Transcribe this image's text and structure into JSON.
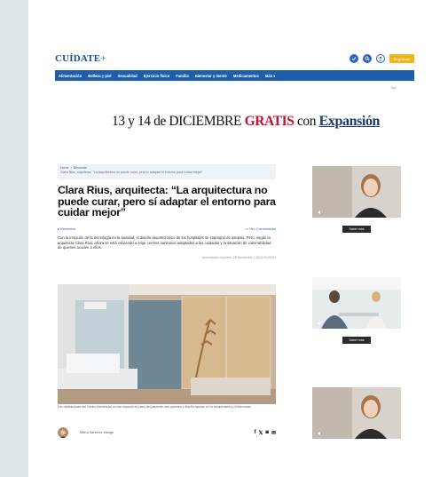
{
  "header": {
    "logo_main": "CUÍDATE",
    "logo_accent": "+",
    "register_label": "Regístrate"
  },
  "nav": {
    "items": [
      "Alimentación",
      "Belleza y piel",
      "Sexualidad",
      "Ejercicio físico",
      "Familia",
      "Bienestar y mente",
      "Medicamentos",
      "Más"
    ]
  },
  "ad_label": "Ad",
  "promo": {
    "before": "13 y 14 de DICIEMBRE",
    "red": "GRATIS",
    "middle": "con",
    "brand": "Expansión"
  },
  "article": {
    "breadcrumb_root": "Home",
    "breadcrumb_section": "Bienestar",
    "breadcrumb_current": "Clara Rius, arquitecta: \"La arquitectura no puede curar, pero sí adaptar el entorno para cuidar mejor\"",
    "title": "Clara Rius, arquitecta: “La arquitectura no puede curar, pero sí adaptar el entorno para cuidar mejor”",
    "section": "Bienestar",
    "comments": "Ver Comentarios",
    "lead": "Con la irrupción de la tecnología en la sanidad, el diseño arquitectónico de los hospitales se impregnó de asepsia. Pero, según la arquitecta Clara Rius, ahora se está volviendo a erigir centros sanitarios adaptados a los cuidados y la situación de vulnerabilidad de quienes acuden a ellos.",
    "date": "Actualizado a jueves, 28 Noviembre | 2024 09:32:39",
    "caption": "Las habitaciones del Centro Asistencial no son espacio de paso del paciente: sus paredes y diseño ayudan en la recuperación y el bienestar.",
    "author": "María Sánchez Monge"
  },
  "sidebar": {
    "videos": [
      {
        "button_label": "Saber más"
      },
      {
        "button_label": "Saber más"
      },
      {
        "button_label": ""
      }
    ]
  },
  "colors": {
    "nav_blue": "#1f5ea8",
    "accent_red": "#c8102e",
    "register_yellow": "#f0b41c"
  }
}
